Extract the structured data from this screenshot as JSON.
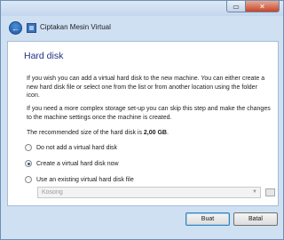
{
  "window": {
    "minimize_glyph": "▭",
    "close_glyph": "✕"
  },
  "header": {
    "back_glyph": "←",
    "title": "Ciptakan Mesin Virtual"
  },
  "page": {
    "title": "Hard disk",
    "paragraph1": "If you wish you can add a virtual hard disk to the new machine. You can either create a new hard disk file or select one from the list or from another location using the folder icon.",
    "paragraph2": "If you need a more complex storage set-up you can skip this step and make the changes to the machine settings once the machine is created.",
    "recommended_prefix": "The recommended size of the hard disk is ",
    "recommended_size": "2,00 GB",
    "recommended_suffix": "."
  },
  "options": [
    {
      "label": "Do not add a virtual hard disk",
      "checked": false
    },
    {
      "label": "Create a virtual hard disk now",
      "checked": true
    },
    {
      "label": "Use an existing virtual hard disk file",
      "checked": false
    }
  ],
  "existing_file": {
    "selected": "Kosong",
    "arrow": "▼"
  },
  "buttons": {
    "create": "Buat",
    "cancel": "Batal"
  }
}
